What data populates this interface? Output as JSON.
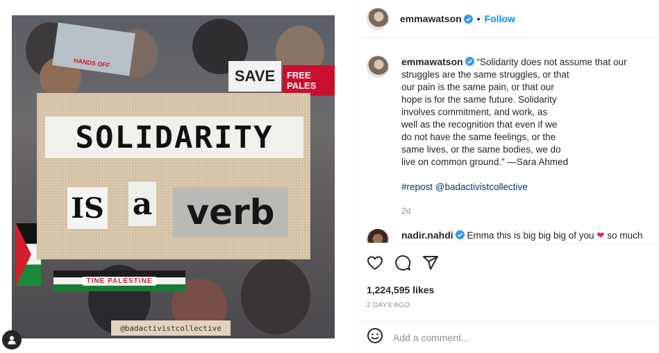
{
  "post": {
    "author": "emmawatson",
    "follow_label": "Follow",
    "separator": "•",
    "image": {
      "headline": "SOLIDARITY",
      "word_is": "IS",
      "word_a": "a",
      "word_verb": "verb",
      "watermark": "@badactivistcollective",
      "banner_text": "TINE   PALESTINE",
      "sign_save": "SAVE",
      "sign_free": "FREE PALES",
      "sign_hands": "HANDS OFF"
    },
    "caption": {
      "author": "emmawatson",
      "text": " “Solidarity does not assume that our\nstruggles are the same struggles, or that\nour pain is the same pain, or that our\nhope is for the same future. Solidarity\ninvolves commitment, and work, as\nwell as the recognition that even if we\ndo not have the same feelings, or the\nsame lives, or the same bodies, we do\nlive on common ground.” —Sara Ahmed",
      "hashtags": "#repost @badactivistcollective",
      "time_ago": "2d"
    },
    "comment": {
      "author": "nadir.nahdi",
      "text_before": " Emma this is big big big of you ",
      "emoji": "❤",
      "text_after": " so much"
    },
    "likes": "1,224,595 likes",
    "date": "2 DAYS AGO",
    "add_comment_placeholder": "Add a comment..."
  },
  "icons": {
    "like": "heart-icon",
    "comment": "comment-icon",
    "share": "share-icon",
    "emoji": "emoji-icon",
    "verified": "verified-badge-icon",
    "profile": "user-icon"
  },
  "colors": {
    "accent": "#0095f6",
    "verified": "#3897f0",
    "hashtag": "#00376b",
    "muted": "#8e8e8e",
    "heart": "#e0245e"
  }
}
